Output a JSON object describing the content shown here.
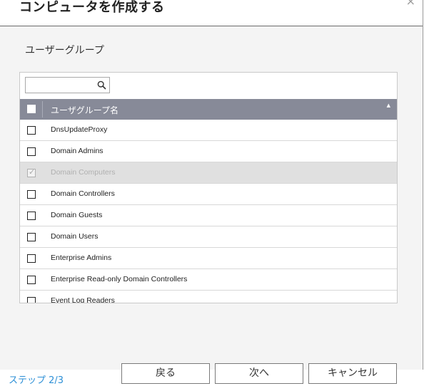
{
  "dialog": {
    "title": "コンピュータを作成する",
    "close_symbol": "×"
  },
  "section": {
    "title": "ユーザーグループ"
  },
  "search": {
    "value": "",
    "placeholder": ""
  },
  "table": {
    "column_header": "ユーザグループ名",
    "sort_indicator": "▲",
    "rows": [
      {
        "name": "DnsUpdateProxy",
        "checked": false,
        "disabled": false
      },
      {
        "name": "Domain Admins",
        "checked": false,
        "disabled": false
      },
      {
        "name": "Domain Computers",
        "checked": true,
        "disabled": true
      },
      {
        "name": "Domain Controllers",
        "checked": false,
        "disabled": false
      },
      {
        "name": "Domain Guests",
        "checked": false,
        "disabled": false
      },
      {
        "name": "Domain Users",
        "checked": false,
        "disabled": false
      },
      {
        "name": "Enterprise Admins",
        "checked": false,
        "disabled": false
      },
      {
        "name": "Enterprise Read-only Domain Controllers",
        "checked": false,
        "disabled": false
      },
      {
        "name": "Event Log Readers",
        "checked": false,
        "disabled": false
      }
    ]
  },
  "footer": {
    "step": "ステップ 2/3",
    "back_label": "戻る",
    "next_label": "次へ",
    "cancel_label": "キャンセル"
  },
  "colors": {
    "accent": "#2c8fd6",
    "table_header": "#878a98",
    "disabled_row": "#e0e0e0"
  }
}
